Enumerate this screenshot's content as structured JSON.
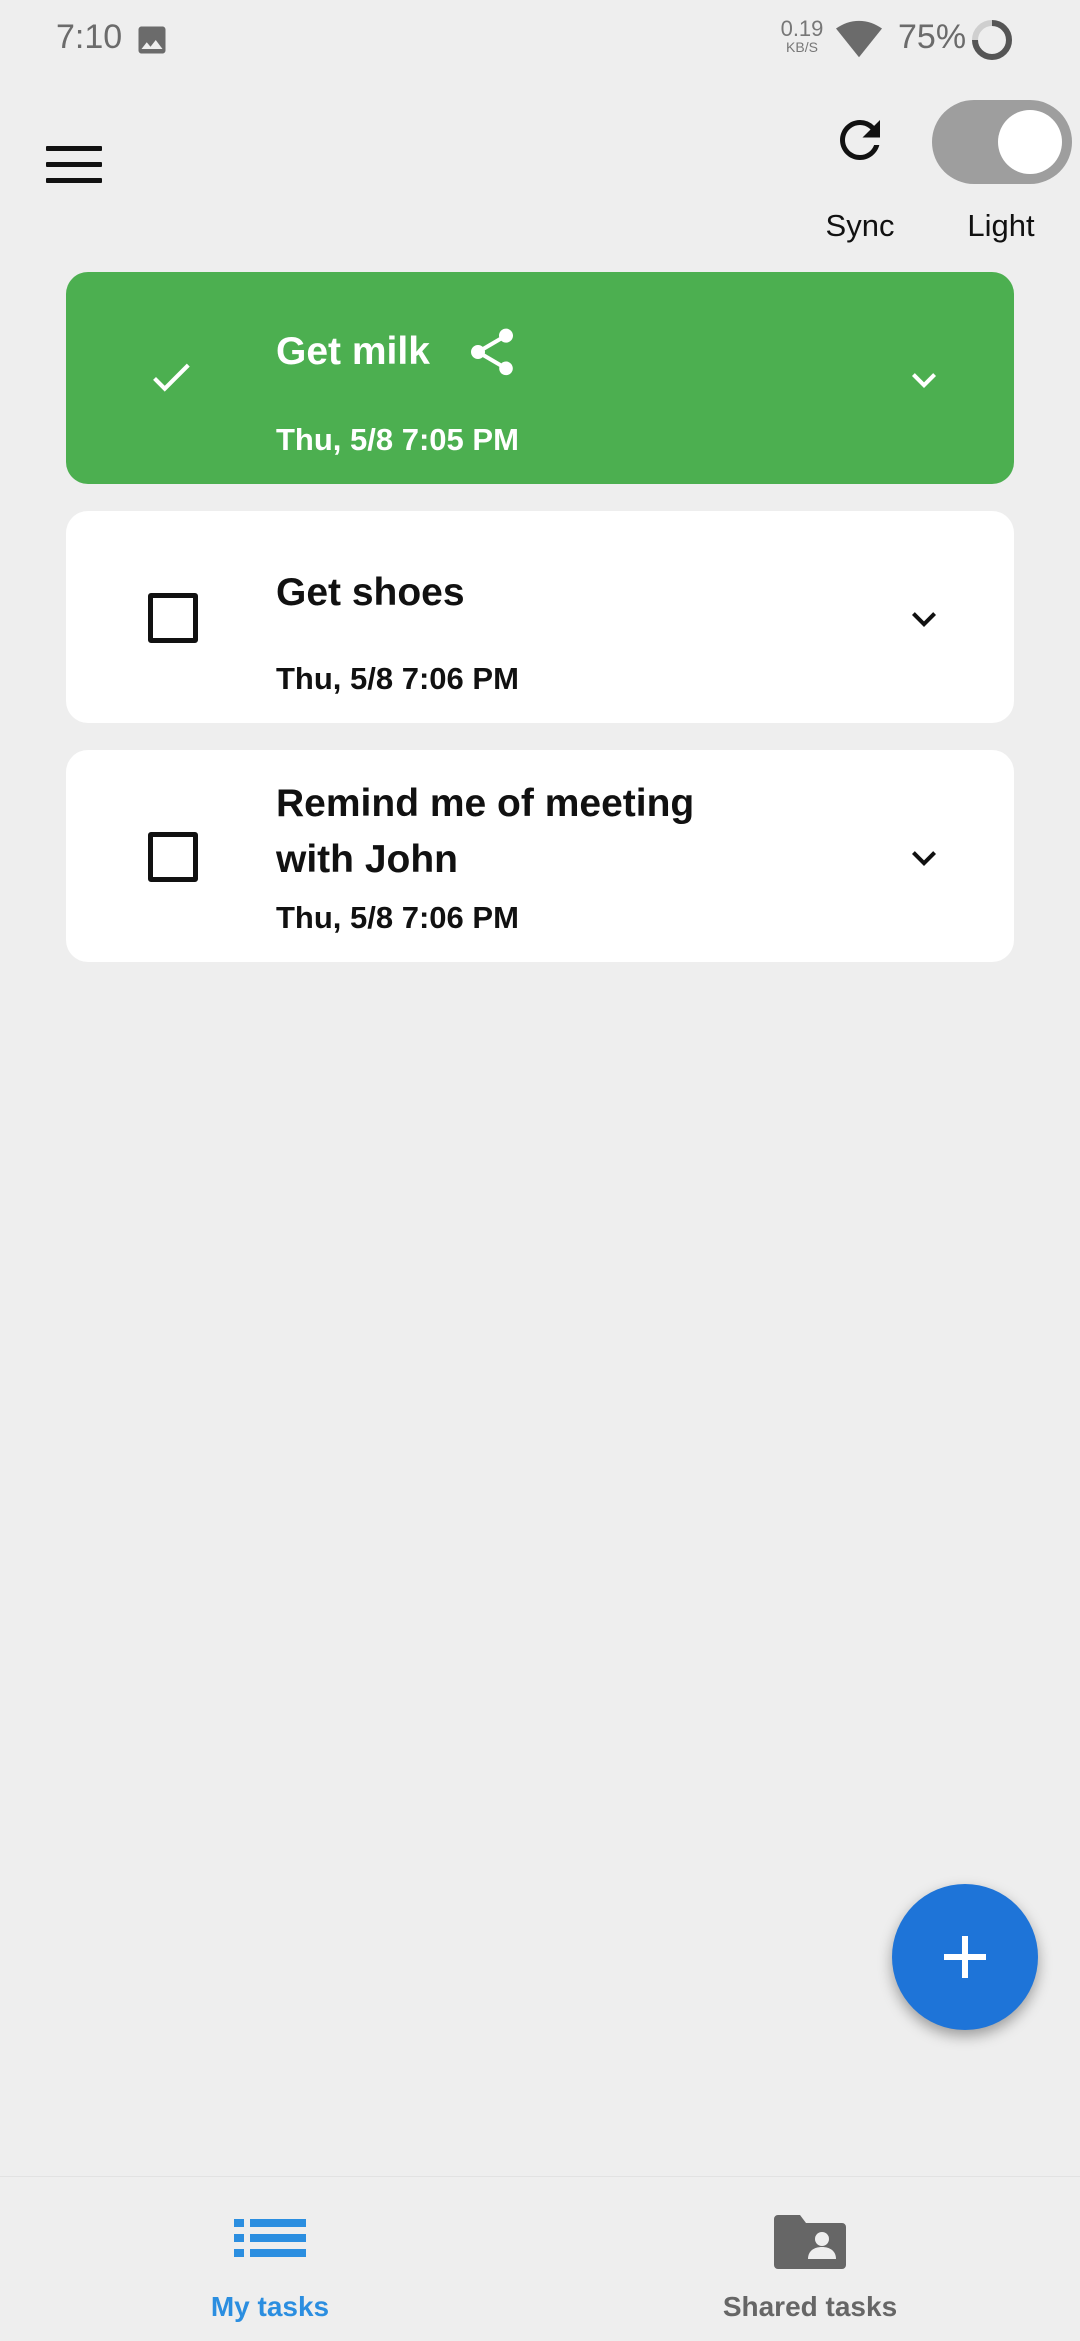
{
  "status_bar": {
    "time": "7:10",
    "net_speed_value": "0.19",
    "net_speed_unit": "KB/S",
    "battery": "75%"
  },
  "toolbar": {
    "sync_label": "Sync",
    "theme_label": "Light",
    "theme_toggle_on": true
  },
  "tasks": [
    {
      "title": "Get milk",
      "date": "Thu, 5/8 7:05 PM",
      "completed": true,
      "shared": true
    },
    {
      "title": "Get shoes",
      "date": "Thu, 5/8 7:06 PM",
      "completed": false,
      "shared": false
    },
    {
      "title": "Remind me of meeting with John",
      "date": "Thu, 5/8 7:06 PM",
      "completed": false,
      "shared": false
    }
  ],
  "bottom_nav": {
    "my_tasks_label": "My tasks",
    "shared_tasks_label": "Shared tasks"
  },
  "colors": {
    "completed_card": "#4caf50",
    "fab": "#1e74d8",
    "active_nav": "#2b8ee0",
    "background": "#eeeeee"
  },
  "icons": {
    "menu": "hamburger-icon",
    "sync": "refresh-icon",
    "share": "share-icon",
    "expand": "chevron-down-icon",
    "fab": "plus-icon",
    "my_tasks": "list-icon",
    "shared_tasks": "shared-folder-icon"
  }
}
